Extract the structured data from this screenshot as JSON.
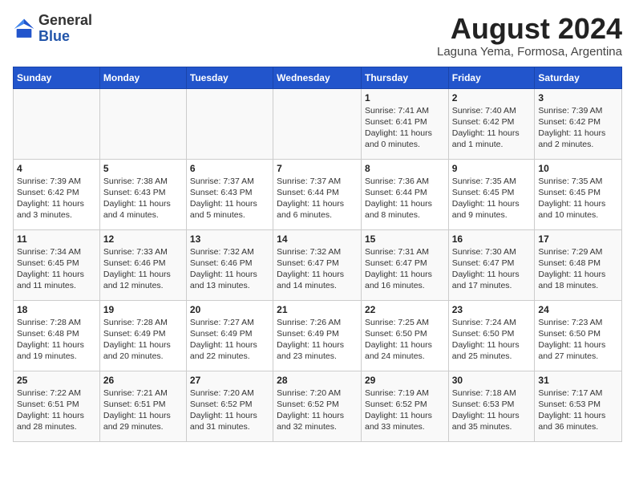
{
  "header": {
    "logo_general": "General",
    "logo_blue": "Blue",
    "month_year": "August 2024",
    "location": "Laguna Yema, Formosa, Argentina"
  },
  "weekdays": [
    "Sunday",
    "Monday",
    "Tuesday",
    "Wednesday",
    "Thursday",
    "Friday",
    "Saturday"
  ],
  "weeks": [
    [
      {
        "num": "",
        "info": ""
      },
      {
        "num": "",
        "info": ""
      },
      {
        "num": "",
        "info": ""
      },
      {
        "num": "",
        "info": ""
      },
      {
        "num": "1",
        "info": "Sunrise: 7:41 AM\nSunset: 6:41 PM\nDaylight: 11 hours\nand 0 minutes."
      },
      {
        "num": "2",
        "info": "Sunrise: 7:40 AM\nSunset: 6:42 PM\nDaylight: 11 hours\nand 1 minute."
      },
      {
        "num": "3",
        "info": "Sunrise: 7:39 AM\nSunset: 6:42 PM\nDaylight: 11 hours\nand 2 minutes."
      }
    ],
    [
      {
        "num": "4",
        "info": "Sunrise: 7:39 AM\nSunset: 6:42 PM\nDaylight: 11 hours\nand 3 minutes."
      },
      {
        "num": "5",
        "info": "Sunrise: 7:38 AM\nSunset: 6:43 PM\nDaylight: 11 hours\nand 4 minutes."
      },
      {
        "num": "6",
        "info": "Sunrise: 7:37 AM\nSunset: 6:43 PM\nDaylight: 11 hours\nand 5 minutes."
      },
      {
        "num": "7",
        "info": "Sunrise: 7:37 AM\nSunset: 6:44 PM\nDaylight: 11 hours\nand 6 minutes."
      },
      {
        "num": "8",
        "info": "Sunrise: 7:36 AM\nSunset: 6:44 PM\nDaylight: 11 hours\nand 8 minutes."
      },
      {
        "num": "9",
        "info": "Sunrise: 7:35 AM\nSunset: 6:45 PM\nDaylight: 11 hours\nand 9 minutes."
      },
      {
        "num": "10",
        "info": "Sunrise: 7:35 AM\nSunset: 6:45 PM\nDaylight: 11 hours\nand 10 minutes."
      }
    ],
    [
      {
        "num": "11",
        "info": "Sunrise: 7:34 AM\nSunset: 6:45 PM\nDaylight: 11 hours\nand 11 minutes."
      },
      {
        "num": "12",
        "info": "Sunrise: 7:33 AM\nSunset: 6:46 PM\nDaylight: 11 hours\nand 12 minutes."
      },
      {
        "num": "13",
        "info": "Sunrise: 7:32 AM\nSunset: 6:46 PM\nDaylight: 11 hours\nand 13 minutes."
      },
      {
        "num": "14",
        "info": "Sunrise: 7:32 AM\nSunset: 6:47 PM\nDaylight: 11 hours\nand 14 minutes."
      },
      {
        "num": "15",
        "info": "Sunrise: 7:31 AM\nSunset: 6:47 PM\nDaylight: 11 hours\nand 16 minutes."
      },
      {
        "num": "16",
        "info": "Sunrise: 7:30 AM\nSunset: 6:47 PM\nDaylight: 11 hours\nand 17 minutes."
      },
      {
        "num": "17",
        "info": "Sunrise: 7:29 AM\nSunset: 6:48 PM\nDaylight: 11 hours\nand 18 minutes."
      }
    ],
    [
      {
        "num": "18",
        "info": "Sunrise: 7:28 AM\nSunset: 6:48 PM\nDaylight: 11 hours\nand 19 minutes."
      },
      {
        "num": "19",
        "info": "Sunrise: 7:28 AM\nSunset: 6:49 PM\nDaylight: 11 hours\nand 20 minutes."
      },
      {
        "num": "20",
        "info": "Sunrise: 7:27 AM\nSunset: 6:49 PM\nDaylight: 11 hours\nand 22 minutes."
      },
      {
        "num": "21",
        "info": "Sunrise: 7:26 AM\nSunset: 6:49 PM\nDaylight: 11 hours\nand 23 minutes."
      },
      {
        "num": "22",
        "info": "Sunrise: 7:25 AM\nSunset: 6:50 PM\nDaylight: 11 hours\nand 24 minutes."
      },
      {
        "num": "23",
        "info": "Sunrise: 7:24 AM\nSunset: 6:50 PM\nDaylight: 11 hours\nand 25 minutes."
      },
      {
        "num": "24",
        "info": "Sunrise: 7:23 AM\nSunset: 6:50 PM\nDaylight: 11 hours\nand 27 minutes."
      }
    ],
    [
      {
        "num": "25",
        "info": "Sunrise: 7:22 AM\nSunset: 6:51 PM\nDaylight: 11 hours\nand 28 minutes."
      },
      {
        "num": "26",
        "info": "Sunrise: 7:21 AM\nSunset: 6:51 PM\nDaylight: 11 hours\nand 29 minutes."
      },
      {
        "num": "27",
        "info": "Sunrise: 7:20 AM\nSunset: 6:52 PM\nDaylight: 11 hours\nand 31 minutes."
      },
      {
        "num": "28",
        "info": "Sunrise: 7:20 AM\nSunset: 6:52 PM\nDaylight: 11 hours\nand 32 minutes."
      },
      {
        "num": "29",
        "info": "Sunrise: 7:19 AM\nSunset: 6:52 PM\nDaylight: 11 hours\nand 33 minutes."
      },
      {
        "num": "30",
        "info": "Sunrise: 7:18 AM\nSunset: 6:53 PM\nDaylight: 11 hours\nand 35 minutes."
      },
      {
        "num": "31",
        "info": "Sunrise: 7:17 AM\nSunset: 6:53 PM\nDaylight: 11 hours\nand 36 minutes."
      }
    ]
  ]
}
